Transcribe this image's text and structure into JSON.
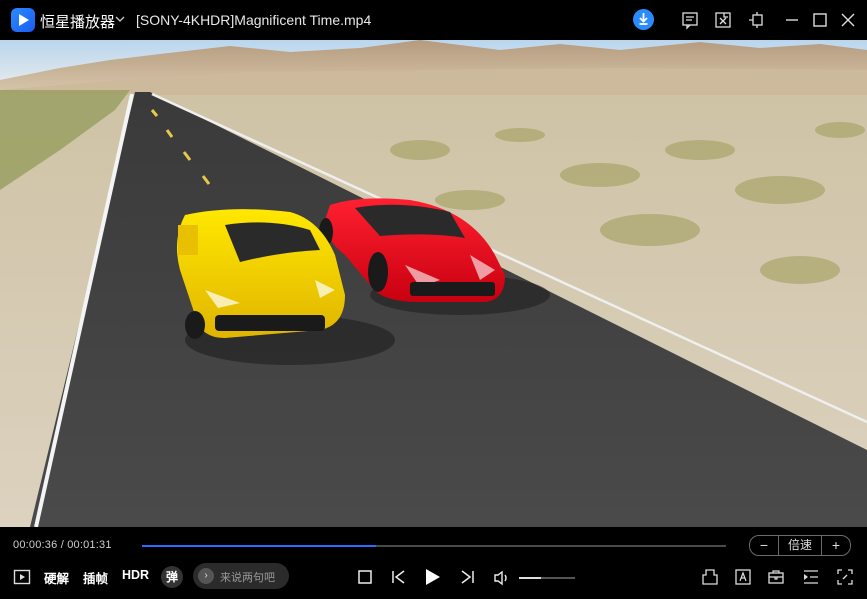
{
  "app": {
    "name": "恒星播放器",
    "file_title": "[SONY-4KHDR]Magnificent Time.mp4"
  },
  "titlebar": {
    "icons": [
      "download-icon",
      "playlist-icon",
      "screenshot-icon",
      "pin-icon",
      "minimize-icon",
      "maximize-icon",
      "close-icon"
    ]
  },
  "playback": {
    "current_time": "00:00:36",
    "separator": "/",
    "total_time": "00:01:31",
    "progress": 0.4
  },
  "speed": {
    "minus": "−",
    "label": "倍速",
    "plus": "+"
  },
  "toolbar": {
    "hw_decode_label": "硬解",
    "frame_insert_label": "插帧",
    "hdr_label": "HDR",
    "danmu_toggle_label": "弹",
    "danmu_placeholder": "来说两句吧",
    "volume_level": 0.4
  },
  "colors": {
    "accent": "#2a6cff",
    "brand": "#2a8bff"
  }
}
